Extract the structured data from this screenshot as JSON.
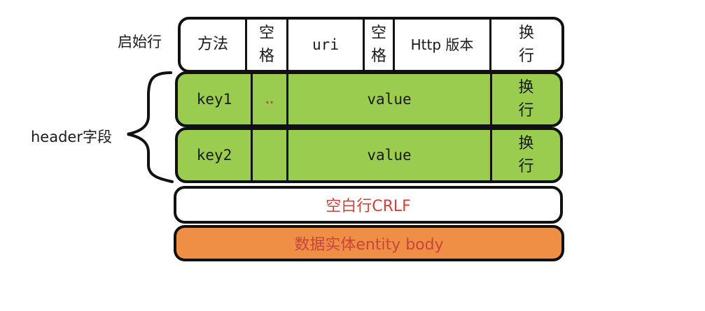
{
  "labels": {
    "start_line": "启始行",
    "header_fields": "header字段"
  },
  "start_line": {
    "method": "方法",
    "space1": [
      "空",
      "格"
    ],
    "uri": "uri",
    "space2": [
      "空",
      "格"
    ],
    "version": "Http 版本",
    "newline": [
      "换",
      "行"
    ]
  },
  "headers": [
    {
      "key": "key1",
      "sep": "..",
      "value": "value",
      "newline": [
        "换",
        "行"
      ]
    },
    {
      "key": "key2",
      "sep": "",
      "value": "value",
      "newline": [
        "换",
        "行"
      ]
    }
  ],
  "blank_line": "空白行CRLF",
  "entity_body": "数据实体entity body",
  "colors": {
    "start_line_bg": "#ffffff",
    "header_bg": "#9acd4f",
    "blank_line_bg": "#ffffff",
    "entity_bg": "#ef8f45",
    "label_red": "#c8443c",
    "stroke": "#111111"
  }
}
